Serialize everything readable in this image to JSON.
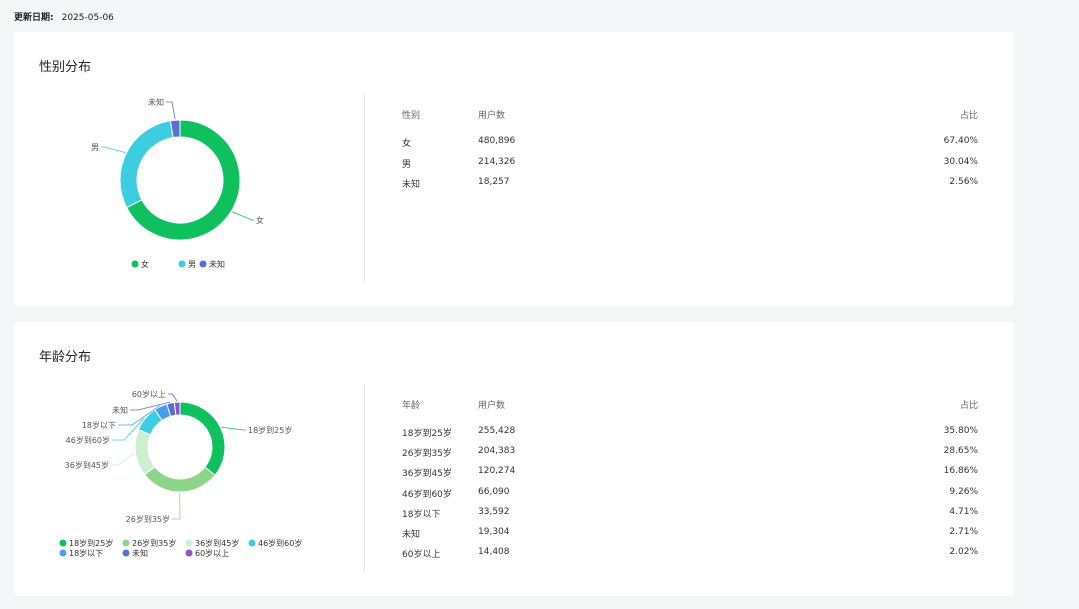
{
  "update": {
    "label": "更新日期:",
    "date": "2025-05-06"
  },
  "gender": {
    "title": "性别分布",
    "headers": {
      "c1": "性别",
      "c2": "用户数",
      "c3": "占比"
    },
    "rows": [
      {
        "name": "女",
        "count": "480,896",
        "pct": "67.40%"
      },
      {
        "name": "男",
        "count": "214,326",
        "pct": "30.04%"
      },
      {
        "name": "未知",
        "count": "18,257",
        "pct": "2.56%"
      }
    ]
  },
  "age": {
    "title": "年龄分布",
    "headers": {
      "c1": "年龄",
      "c2": "用户数",
      "c3": "占比"
    },
    "rows": [
      {
        "name": "18岁到25岁",
        "count": "255,428",
        "pct": "35.80%"
      },
      {
        "name": "26岁到35岁",
        "count": "204,383",
        "pct": "28.65%"
      },
      {
        "name": "36岁到45岁",
        "count": "120,274",
        "pct": "16.86%"
      },
      {
        "name": "46岁到60岁",
        "count": "66,090",
        "pct": "9.26%"
      },
      {
        "name": "18岁以下",
        "count": "33,592",
        "pct": "4.71%"
      },
      {
        "name": "未知",
        "count": "19,304",
        "pct": "2.71%"
      },
      {
        "name": "60岁以上",
        "count": "14,408",
        "pct": "2.02%"
      }
    ]
  },
  "chart_data": [
    {
      "type": "pie",
      "donut": true,
      "title": "性别分布",
      "categories": [
        "女",
        "男",
        "未知"
      ],
      "values": [
        67.4,
        30.04,
        2.56
      ],
      "colors": [
        "#0fc15e",
        "#3ccde0",
        "#5a6fd6"
      ],
      "legend": "bottom"
    },
    {
      "type": "pie",
      "donut": true,
      "title": "年龄分布",
      "categories": [
        "18岁到25岁",
        "26岁到35岁",
        "36岁到45岁",
        "46岁到60岁",
        "18岁以下",
        "未知",
        "60岁以上"
      ],
      "values": [
        35.8,
        28.65,
        16.86,
        9.26,
        4.71,
        2.71,
        2.02
      ],
      "colors": [
        "#0fc15e",
        "#8bd68a",
        "#cdeed0",
        "#3ccde0",
        "#4a9de8",
        "#5a6fd6",
        "#8a55c9"
      ],
      "legend": "bottom"
    }
  ]
}
